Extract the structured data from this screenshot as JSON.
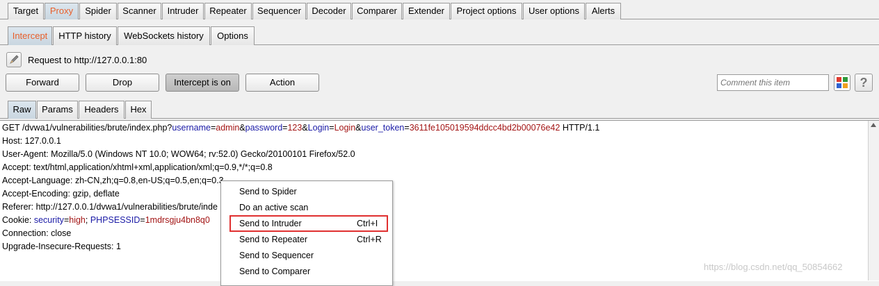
{
  "main_tabs": [
    "Target",
    "Proxy",
    "Spider",
    "Scanner",
    "Intruder",
    "Repeater",
    "Sequencer",
    "Decoder",
    "Comparer",
    "Extender",
    "Project options",
    "User options",
    "Alerts"
  ],
  "sub_tabs": [
    "Intercept",
    "HTTP history",
    "WebSockets history",
    "Options"
  ],
  "request_label": "Request to http://127.0.0.1:80",
  "buttons": {
    "forward": "Forward",
    "drop": "Drop",
    "intercept": "Intercept is on",
    "action": "Action"
  },
  "comment_placeholder": "Comment this item",
  "help_label": "?",
  "view_tabs": [
    "Raw",
    "Params",
    "Headers",
    "Hex"
  ],
  "request": {
    "line1": {
      "p1": "GET /dvwa1/vulnerabilities/brute/index.php?",
      "k1": "username",
      "e1": "=",
      "v1": "admin",
      "a1": "&",
      "k2": "password",
      "e2": "=",
      "v2": "123",
      "a2": "&",
      "k3": "Login",
      "e3": "=",
      "v3": "Login",
      "a3": "&",
      "k4": "user_token",
      "e4": "=",
      "v4": "3611fe105019594ddcc4bd2b00076e42",
      "p2": " HTTP/1.1"
    },
    "host": "Host: 127.0.0.1",
    "user_agent": "User-Agent: Mozilla/5.0 (Windows NT 10.0; WOW64; rv:52.0) Gecko/20100101 Firefox/52.0",
    "accept": "Accept: text/html,application/xhtml+xml,application/xml;q=0.9,*/*;q=0.8",
    "accept_language": "Accept-Language: zh-CN,zh;q=0.8,en-US;q=0.5,en;q=0.3",
    "accept_encoding": "Accept-Encoding: gzip, deflate",
    "referer": "Referer: http://127.0.0.1/dvwa1/vulnerabilities/brute/inde",
    "cookie": {
      "p": "Cookie: ",
      "k1": "security",
      "e1": "=",
      "v1": "high",
      "s": "; ",
      "k2": "PHPSESSID",
      "e2": "=",
      "v2": "1mdrsgju4bn8q0"
    },
    "connection": "Connection: close",
    "upgrade": "Upgrade-Insecure-Requests: 1"
  },
  "context_menu": [
    {
      "label": "Send to Spider",
      "shortcut": ""
    },
    {
      "label": "Do an active scan",
      "shortcut": ""
    },
    {
      "label": "Send to Intruder",
      "shortcut": "Ctrl+I"
    },
    {
      "label": "Send to Repeater",
      "shortcut": "Ctrl+R"
    },
    {
      "label": "Send to Sequencer",
      "shortcut": ""
    },
    {
      "label": "Send to Comparer",
      "shortcut": ""
    }
  ],
  "watermark": "https://blog.csdn.net/qq_50854662",
  "colors": {
    "active_tab_text": "#e8602c",
    "param_name": "#1a1aa6",
    "param_value": "#a31515",
    "highlight": "#e03030"
  }
}
